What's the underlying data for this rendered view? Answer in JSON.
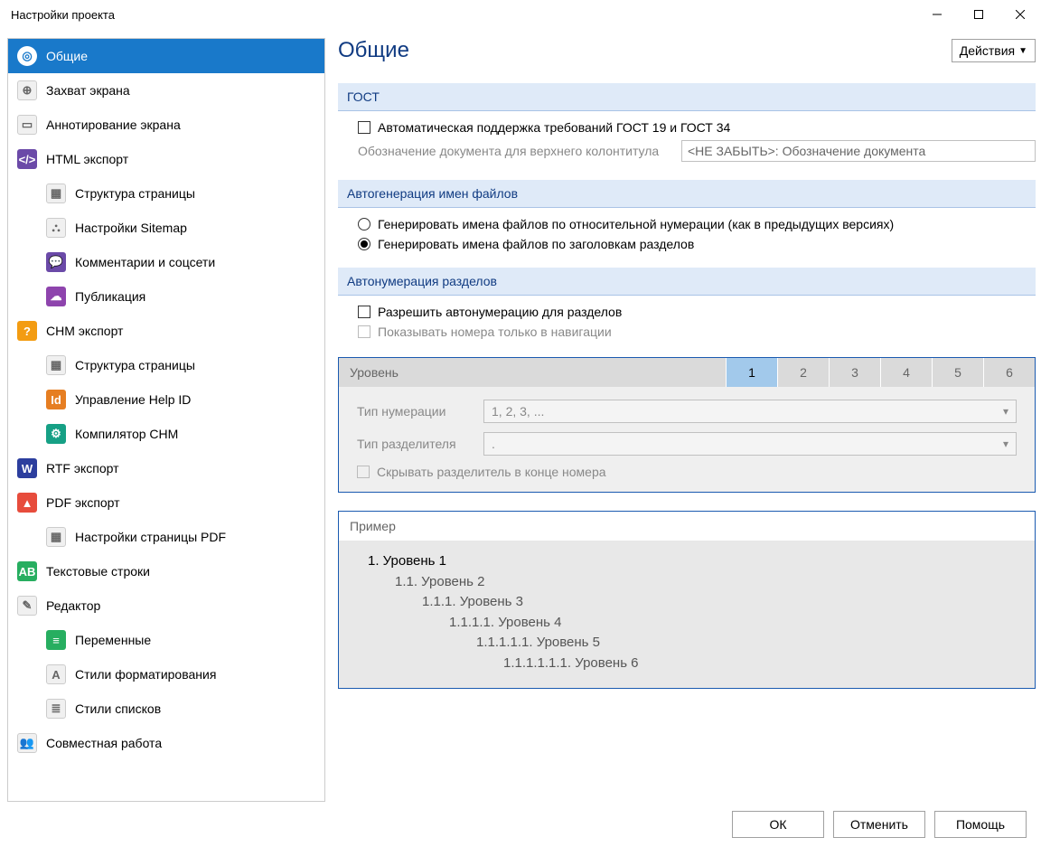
{
  "window": {
    "title": "Настройки проекта"
  },
  "sidebar": {
    "items": [
      {
        "label": "Общие",
        "icon": "◎",
        "cls": "ico-blue"
      },
      {
        "label": "Захват экрана",
        "icon": "⊕",
        "cls": "ico-gray"
      },
      {
        "label": "Аннотирование экрана",
        "icon": "▭",
        "cls": "ico-gray"
      },
      {
        "label": "HTML экспорт",
        "icon": "</>",
        "cls": "ico-purple"
      },
      {
        "label": "Структура страницы",
        "icon": "▦",
        "cls": "ico-gray",
        "indent": true
      },
      {
        "label": "Настройки Sitemap",
        "icon": "⛬",
        "cls": "ico-gray",
        "indent": true
      },
      {
        "label": "Комментарии и соцсети",
        "icon": "💬",
        "cls": "ico-purple",
        "indent": true
      },
      {
        "label": "Публикация",
        "icon": "☁",
        "cls": "ico-cloud",
        "indent": true
      },
      {
        "label": "CHM экспорт",
        "icon": "?",
        "cls": "ico-orange"
      },
      {
        "label": "Структура страницы",
        "icon": "▦",
        "cls": "ico-gray",
        "indent": true
      },
      {
        "label": "Управление Help ID",
        "icon": "Id",
        "cls": "ico-idorange",
        "indent": true
      },
      {
        "label": "Компилятор CHM",
        "icon": "⚙",
        "cls": "ico-teal",
        "indent": true
      },
      {
        "label": "RTF экспорт",
        "icon": "W",
        "cls": "ico-darkblue"
      },
      {
        "label": "PDF экспорт",
        "icon": "▲",
        "cls": "ico-red"
      },
      {
        "label": "Настройки страницы PDF",
        "icon": "▦",
        "cls": "ico-gray",
        "indent": true
      },
      {
        "label": "Текстовые строки",
        "icon": "AB",
        "cls": "ico-green"
      },
      {
        "label": "Редактор",
        "icon": "✎",
        "cls": "ico-gray"
      },
      {
        "label": "Переменные",
        "icon": "≡",
        "cls": "ico-green",
        "indent": true
      },
      {
        "label": "Стили форматирования",
        "icon": "A",
        "cls": "ico-gray",
        "indent": true
      },
      {
        "label": "Стили списков",
        "icon": "≣",
        "cls": "ico-gray",
        "indent": true
      },
      {
        "label": "Совместная работа",
        "icon": "👥",
        "cls": "ico-gray"
      }
    ]
  },
  "content": {
    "title": "Общие",
    "actions_label": "Действия"
  },
  "gost": {
    "header": "ГОСТ",
    "auto_checkbox": "Автоматическая поддержка требований ГОСТ 19 и ГОСТ 34",
    "doc_label": "Обозначение документа для верхнего колонтитула",
    "doc_placeholder": "<НЕ ЗАБЫТЬ>: Обозначение документа"
  },
  "autogen": {
    "header": "Автогенерация имен файлов",
    "opt1": "Генерировать имена файлов по относительной нумерации (как в предыдущих версиях)",
    "opt2": "Генерировать имена файлов по заголовкам разделов"
  },
  "autonum": {
    "header": "Автонумерация разделов",
    "allow": "Разрешить автонумерацию для разделов",
    "show_nav": "Показывать номера только в навигации"
  },
  "level": {
    "label": "Уровень",
    "tabs": [
      "1",
      "2",
      "3",
      "4",
      "5",
      "6"
    ],
    "num_type_label": "Тип нумерации",
    "num_type_value": "1, 2, 3, ...",
    "sep_type_label": "Тип разделителя",
    "sep_type_value": ".",
    "hide_sep": "Скрывать разделитель в конце номера"
  },
  "example": {
    "header": "Пример",
    "l1": "1. Уровень 1",
    "l2": "1.1. Уровень 2",
    "l3": "1.1.1. Уровень 3",
    "l4": "1.1.1.1. Уровень 4",
    "l5": "1.1.1.1.1. Уровень 5",
    "l6": "1.1.1.1.1.1. Уровень 6"
  },
  "footer": {
    "ok": "ОК",
    "cancel": "Отменить",
    "help": "Помощь"
  }
}
